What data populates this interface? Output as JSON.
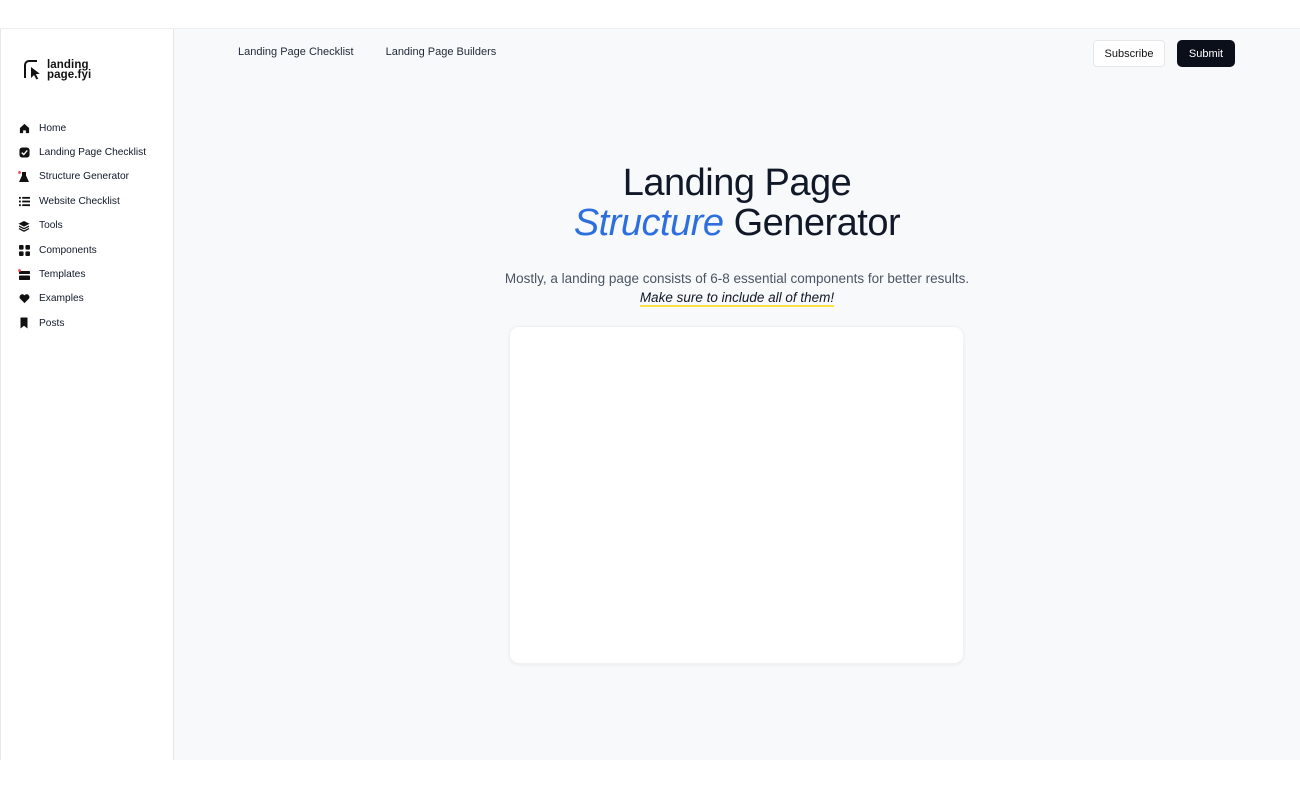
{
  "brand": {
    "line1": "landing",
    "line2": "page.fyi"
  },
  "sidebar": {
    "items": [
      {
        "label": "Home",
        "icon": "home-icon"
      },
      {
        "label": "Landing Page Checklist",
        "icon": "check-badge-icon"
      },
      {
        "label": "Structure Generator",
        "icon": "flask-icon"
      },
      {
        "label": "Website Checklist",
        "icon": "list-icon"
      },
      {
        "label": "Tools",
        "icon": "layers-icon"
      },
      {
        "label": "Components",
        "icon": "grid-icon"
      },
      {
        "label": "Templates",
        "icon": "template-icon"
      },
      {
        "label": "Examples",
        "icon": "heart-icon"
      },
      {
        "label": "Posts",
        "icon": "bookmark-icon"
      }
    ]
  },
  "header": {
    "links": [
      "Landing Page Checklist",
      "Landing Page Builders"
    ],
    "subscribe_label": "Subscribe",
    "submit_label": "Submit"
  },
  "hero": {
    "line1": "Landing Page",
    "accent": "Structure",
    "rest": "Generator",
    "subtitle": "Mostly, a landing page consists of 6-8 essential components for better results.",
    "note": "Make sure to include all of them!"
  },
  "colors": {
    "accent": "#2e6fe0",
    "highlight": "#fde047",
    "dark_button": "#0b0f19",
    "dot": "#ef4444"
  }
}
